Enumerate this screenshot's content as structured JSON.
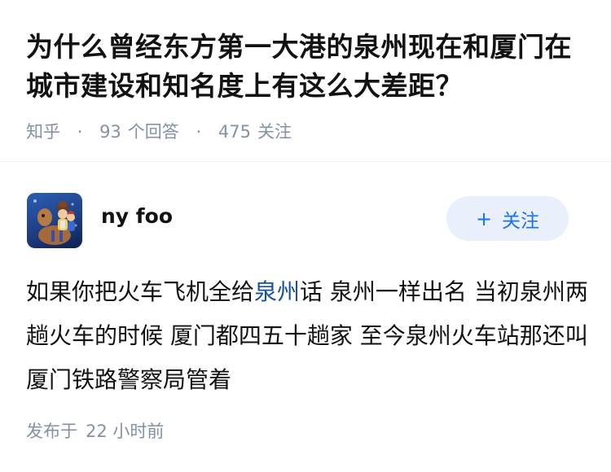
{
  "question": {
    "title": "为什么曾经东方第一大港的泉州现在和厦门在城市建设和知名度上有这么大差距？",
    "source": "知乎",
    "answer_count": "93",
    "answer_label": "个回答",
    "follower_count": "475",
    "follower_label": "关注"
  },
  "answer": {
    "author_name": "ny foo",
    "follow_label": "关注",
    "content_before": "如果你把火车飞机全给",
    "content_link": "泉州",
    "content_after": "话 泉州一样出名 当初泉州两趟火车的时候 厦门都四五十趟家 至今泉州火车站那还叫厦门铁路警察局管着",
    "post_prefix": "发布于",
    "post_time": "22 小时前"
  },
  "colors": {
    "accent": "#1772f6",
    "link": "#175199",
    "meta": "#8590a6",
    "button_bg": "#e9f0fb"
  }
}
